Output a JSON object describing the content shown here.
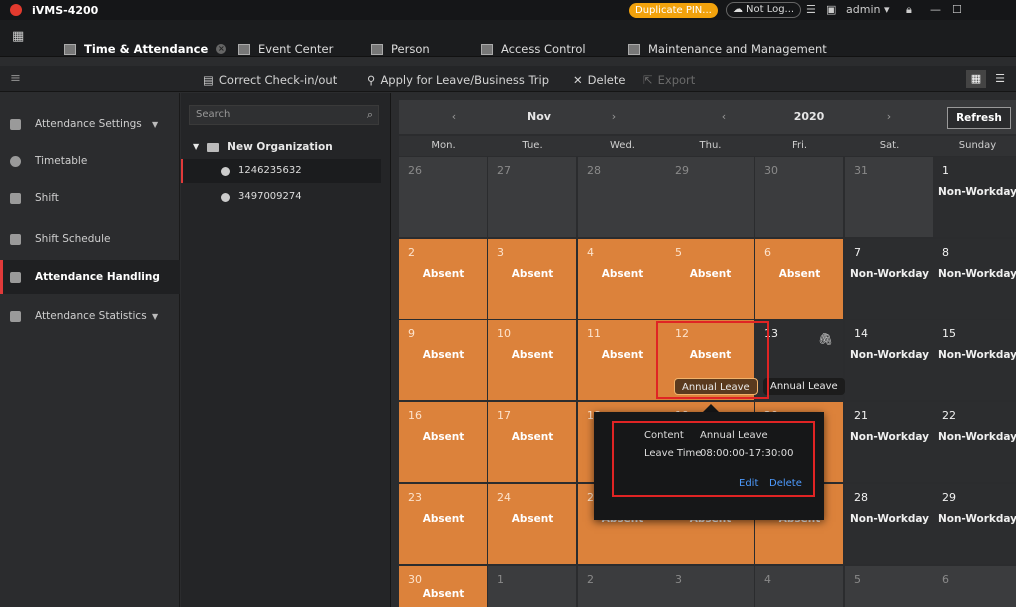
{
  "titlebar": {
    "app_title": "iVMS-4200",
    "duplicate_pin": "Duplicate PIN...",
    "not_logged": "Not Log...",
    "user": "admin"
  },
  "modules": {
    "time_attendance": "Time & Attendance",
    "event_center": "Event Center",
    "person": "Person",
    "access_control": "Access Control",
    "maintenance": "Maintenance and Management"
  },
  "toolbar": {
    "correct_checkin": "Correct Check-in/out",
    "apply_leave": "Apply for Leave/Business Trip",
    "delete": "Delete",
    "export": "Export"
  },
  "nav": {
    "items": [
      {
        "label": "Attendance Settings"
      },
      {
        "label": "Timetable"
      },
      {
        "label": "Shift"
      },
      {
        "label": "Shift Schedule"
      },
      {
        "label": "Attendance Handling"
      },
      {
        "label": "Attendance Statistics"
      }
    ]
  },
  "org": {
    "search_placeholder": "Search",
    "root": "New Organization",
    "persons": [
      "1246235632",
      "3497009274"
    ]
  },
  "calendar": {
    "month": "Nov",
    "year": "2020",
    "refresh": "Refresh",
    "weekdays": [
      "Mon.",
      "Tue.",
      "Wed.",
      "Thu.",
      "Fri.",
      "Sat.",
      "Sunday"
    ],
    "cells": [
      [
        "26",
        "27",
        "28",
        "29",
        "30",
        "31",
        "1"
      ],
      [
        "2",
        "3",
        "4",
        "5",
        "6",
        "7",
        "8"
      ],
      [
        "9",
        "10",
        "11",
        "12",
        "13",
        "14",
        "15"
      ],
      [
        "16",
        "17",
        "18",
        "19",
        "20",
        "21",
        "22"
      ],
      [
        "23",
        "24",
        "25",
        "26",
        "27",
        "28",
        "29"
      ],
      [
        "30",
        "1",
        "2",
        "3",
        "4",
        "5",
        "6"
      ]
    ],
    "absent": "Absent",
    "non_workday": "Non-Workday",
    "leave_tag": "Annual Leave",
    "leave_tag_2": "Annual Leave"
  },
  "popup": {
    "content_label": "Content",
    "content_value": "Annual Leave",
    "leave_time_label": "Leave Time",
    "leave_time_value": "08:00:00-17:30:00",
    "edit": "Edit",
    "delete": "Delete"
  },
  "colors": {
    "absent_orange": "#dc823b",
    "highlight_red": "#e02424",
    "link_blue": "#4d9bff",
    "pin_badge": "#f2a20c"
  }
}
